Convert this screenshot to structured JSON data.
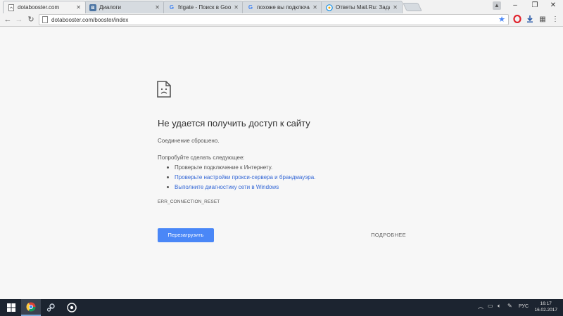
{
  "tabs": [
    {
      "title": "dotabooster.com",
      "favicon": "page-icon",
      "active": true
    },
    {
      "title": "Диалоги",
      "favicon": "vk-icon",
      "active": false
    },
    {
      "title": "frigate - Поиск в Google",
      "favicon": "google-icon",
      "active": false
    },
    {
      "title": "похоже вы подключил",
      "favicon": "google-icon",
      "active": false
    },
    {
      "title": "Ответы Mail.Ru: Задать",
      "favicon": "mailru-icon",
      "active": false
    }
  ],
  "address_bar": {
    "url": "dotabooster.com/booster/index"
  },
  "error": {
    "title": "Не удается получить доступ к сайту",
    "message": "Соединение сброшено.",
    "try_label": "Попробуйте сделать следующее:",
    "suggestions": [
      {
        "text": "Проверьте подключение к Интернету.",
        "link": false
      },
      {
        "text": "Проверьте настройки прокси-сервера и брандмауэра.",
        "link": true
      },
      {
        "text": "Выполните диагностику сети в Windows",
        "link": true
      }
    ],
    "code": "ERR_CONNECTION_RESET",
    "reload_label": "Перезагрузить",
    "details_label": "ПОДРОБНЕЕ"
  },
  "taskbar": {
    "language": "РУС",
    "time": "16:17",
    "date": "16.02.2017"
  },
  "colors": {
    "accent": "#4a87f7",
    "link": "#3367d6",
    "taskbar": "#1c2430"
  }
}
